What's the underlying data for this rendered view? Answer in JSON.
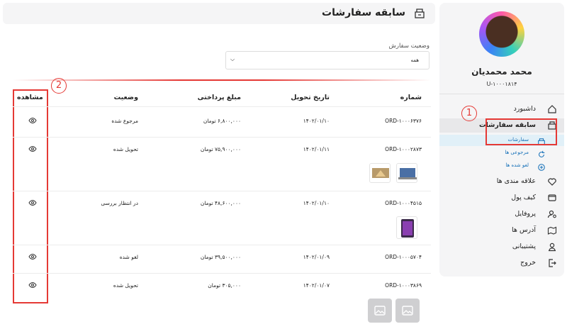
{
  "header": {
    "title": "سابقه سفارشات",
    "icon": "orders-box-icon"
  },
  "sidebar": {
    "user_name": "محمد محمدیان",
    "user_id": "U-۱۰۰۰۱۸۱۴",
    "items": [
      {
        "label": "داشبورد",
        "icon": "home-icon"
      },
      {
        "label": "سابقه سفارشات",
        "icon": "orders-box-icon"
      },
      {
        "label": "سفارشات",
        "icon": "orders-box-icon"
      },
      {
        "label": "مرجوعی ها",
        "icon": "return-icon"
      },
      {
        "label": "لغو شده ها",
        "icon": "cancel-circle-icon"
      },
      {
        "label": "علاقه مندی ها",
        "icon": "heart-icon"
      },
      {
        "label": "کیف پول",
        "icon": "wallet-icon"
      },
      {
        "label": "پروفایل",
        "icon": "user-settings-icon"
      },
      {
        "label": "آدرس ها",
        "icon": "map-icon"
      },
      {
        "label": "پشتیبانی",
        "icon": "support-icon"
      },
      {
        "label": "خروج",
        "icon": "logout-icon"
      }
    ]
  },
  "filter": {
    "label": "وضعیت سفارش",
    "value": "همه"
  },
  "table": {
    "headers": {
      "number": "شماره",
      "date": "تاریخ تحویل",
      "amount": "مبلغ پرداختی",
      "status": "وضعیت",
      "view": "مشاهده"
    },
    "rows": [
      {
        "number": "ORD-۱۰۰۰۶۳۷۶",
        "date": "۱۴۰۲/۰۱/۱۰",
        "amount": "۶,۸۰۰,۰۰۰ تومان",
        "status": "مرجوع شده"
      },
      {
        "number": "ORD-۱۰۰۰۲۸۷۳",
        "date": "۱۴۰۲/۰۱/۱۱",
        "amount": "۷۵,۹۰۰,۰۰۰ تومان",
        "status": "تحویل شده"
      },
      {
        "number": "ORD-۱۰۰۰۴۵۱۵",
        "date": "۱۴۰۲/۰۱/۱۰",
        "amount": "۴۸,۶۰۰,۰۰۰ تومان",
        "status": "در انتظار بررسی"
      },
      {
        "number": "ORD-۱۰۰۰۵۷۰۴",
        "date": "۱۴۰۲/۰۱/۰۹",
        "amount": "۳۹,۵۰۰,۰۰۰ تومان",
        "status": "لغو شده"
      },
      {
        "number": "ORD-۱۰۰۰۳۸۶۹",
        "date": "۱۴۰۲/۰۱/۰۷",
        "amount": "۳۰۵,۰۰۰ تومان",
        "status": "تحویل شده"
      }
    ]
  },
  "annotations": {
    "marker_1": "1",
    "marker_2": "2"
  },
  "colors": {
    "accent": "#1570b8",
    "annotation": "#e53935"
  }
}
